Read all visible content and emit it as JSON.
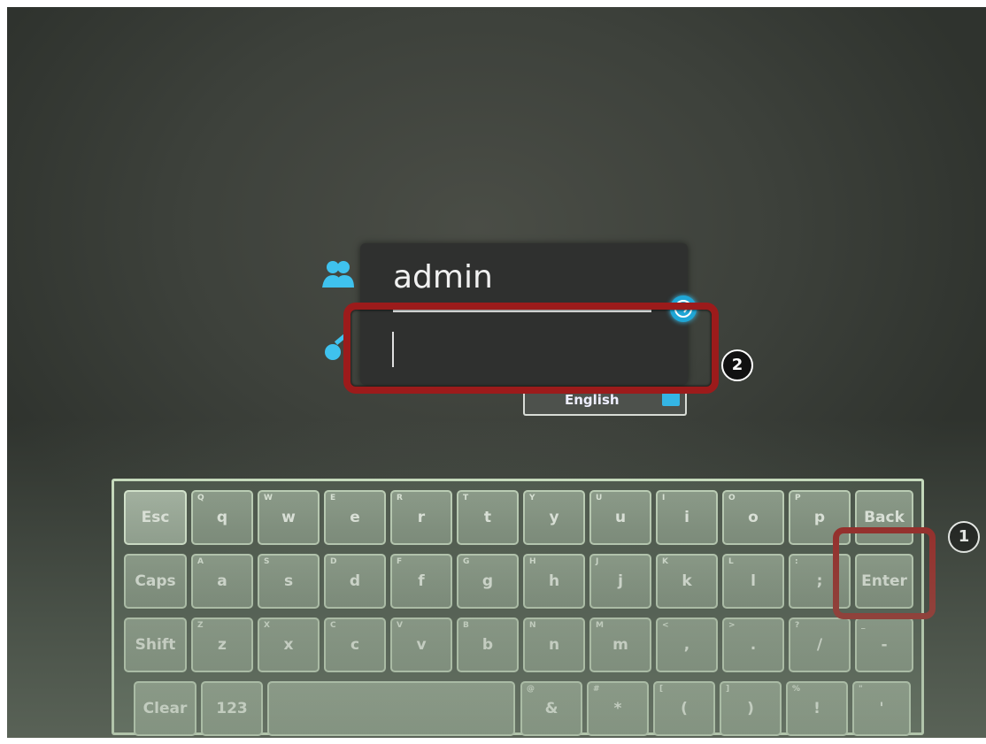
{
  "login": {
    "username": "admin",
    "password_value": "",
    "language": "English"
  },
  "annotations": {
    "marker_enter": "1",
    "marker_password": "2"
  },
  "keyboard": {
    "row1": [
      {
        "label": "Esc",
        "sub": ""
      },
      {
        "label": "q",
        "sub": "Q"
      },
      {
        "label": "w",
        "sub": "W"
      },
      {
        "label": "e",
        "sub": "E"
      },
      {
        "label": "r",
        "sub": "R"
      },
      {
        "label": "t",
        "sub": "T"
      },
      {
        "label": "y",
        "sub": "Y"
      },
      {
        "label": "u",
        "sub": "U"
      },
      {
        "label": "i",
        "sub": "I"
      },
      {
        "label": "o",
        "sub": "O"
      },
      {
        "label": "p",
        "sub": "P"
      },
      {
        "label": "Back",
        "sub": ""
      }
    ],
    "row2": [
      {
        "label": "Caps",
        "sub": ""
      },
      {
        "label": "a",
        "sub": "A"
      },
      {
        "label": "s",
        "sub": "S"
      },
      {
        "label": "d",
        "sub": "D"
      },
      {
        "label": "f",
        "sub": "F"
      },
      {
        "label": "g",
        "sub": "G"
      },
      {
        "label": "h",
        "sub": "H"
      },
      {
        "label": "j",
        "sub": "J"
      },
      {
        "label": "k",
        "sub": "K"
      },
      {
        "label": "l",
        "sub": "L"
      },
      {
        "label": ";",
        "sub": ":"
      },
      {
        "label": "Enter",
        "sub": ""
      }
    ],
    "row3": [
      {
        "label": "Shift",
        "sub": ""
      },
      {
        "label": "z",
        "sub": "Z"
      },
      {
        "label": "x",
        "sub": "X"
      },
      {
        "label": "c",
        "sub": "C"
      },
      {
        "label": "v",
        "sub": "V"
      },
      {
        "label": "b",
        "sub": "B"
      },
      {
        "label": "n",
        "sub": "N"
      },
      {
        "label": "m",
        "sub": "M"
      },
      {
        "label": ",",
        "sub": "<"
      },
      {
        "label": ".",
        "sub": ">"
      },
      {
        "label": "/",
        "sub": "?"
      },
      {
        "label": "-",
        "sub": "_"
      }
    ],
    "row4": [
      {
        "label": "Clear",
        "sub": ""
      },
      {
        "label": "123",
        "sub": ""
      },
      {
        "label": "",
        "sub": ""
      },
      {
        "label": "&",
        "sub": "@"
      },
      {
        "label": "*",
        "sub": "#"
      },
      {
        "label": "(",
        "sub": "["
      },
      {
        "label": ")",
        "sub": "]"
      },
      {
        "label": "!",
        "sub": "%"
      },
      {
        "label": "'",
        "sub": "\""
      }
    ]
  },
  "colors": {
    "accent": "#1fa6d6",
    "highlight": "#9c1b1b"
  },
  "icons": {
    "user": "users-icon",
    "password": "key-icon",
    "login": "arrow-circle-icon"
  }
}
